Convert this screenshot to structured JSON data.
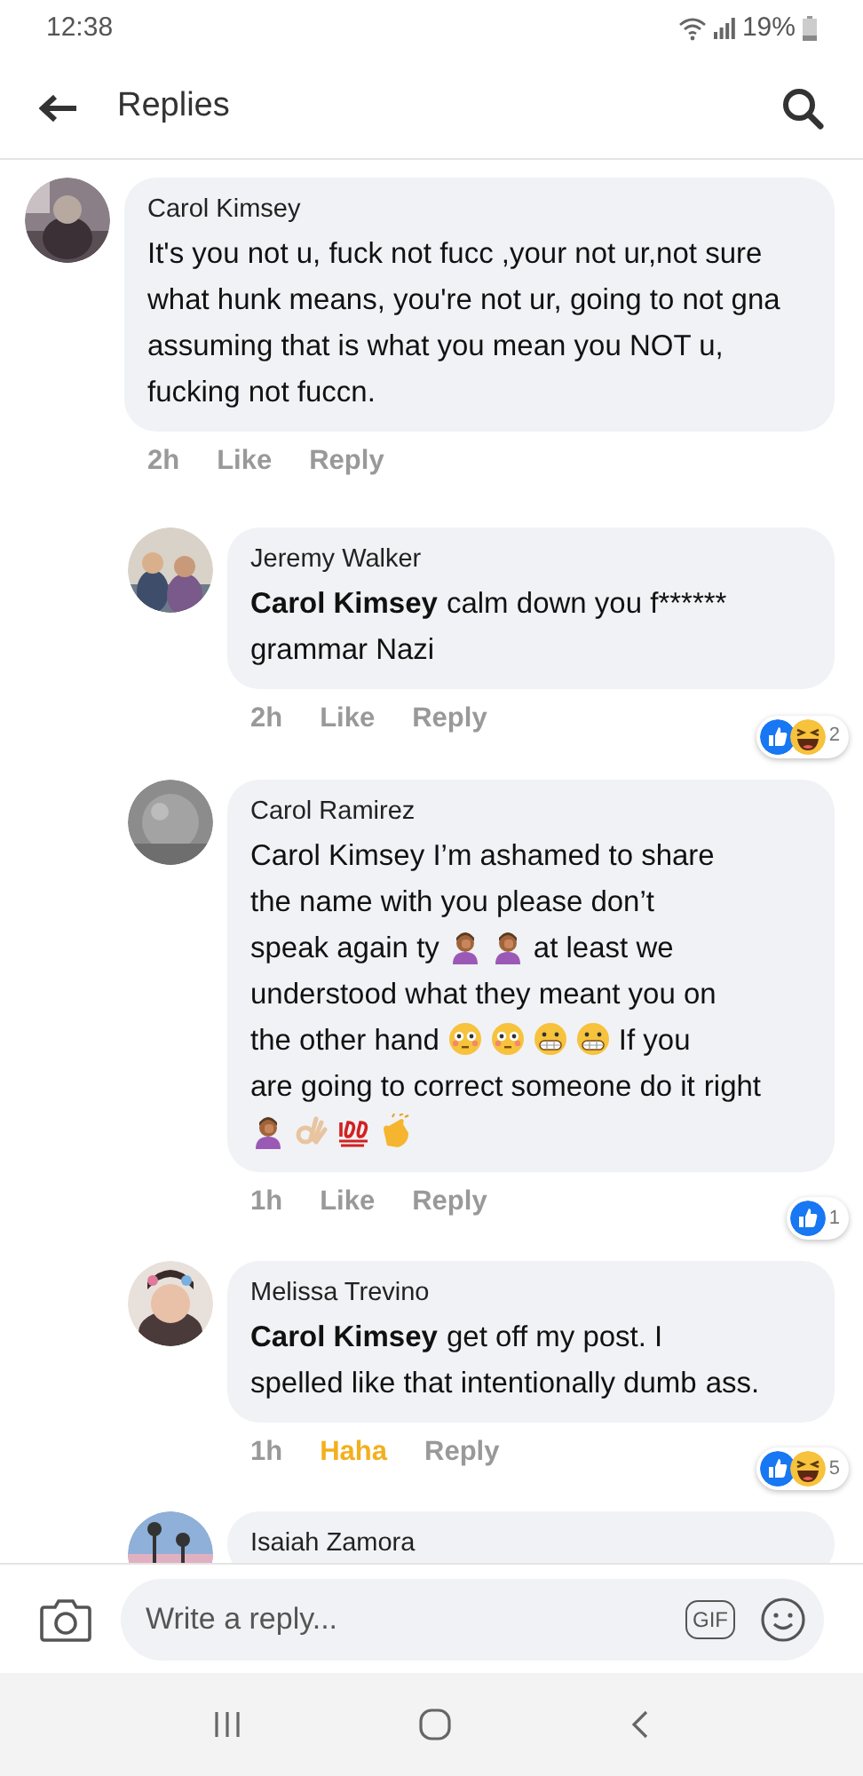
{
  "status_bar": {
    "time": "12:38",
    "battery": "19%"
  },
  "header": {
    "title": "Replies"
  },
  "comments": [
    {
      "author": "Carol Kimsey",
      "body": [
        {
          "kind": "text",
          "text": "It's you not u, fuck not fucc ,your not ur,not sure what hunk means, you're not ur, going to not gna assuming that is what you mean  you NOT u, fucking not fuccn."
        }
      ],
      "time": "2h",
      "like_label": "Like",
      "reacted": false,
      "reply_label": "Reply",
      "children": [
        {
          "author": "Jeremy Walker",
          "body": [
            {
              "kind": "mention",
              "text": "Carol Kimsey"
            },
            {
              "kind": "line",
              "text": "calm down you f******"
            },
            {
              "kind": "line",
              "text": "grammar Nazi"
            }
          ],
          "time": "2h",
          "like_label": "Like",
          "reacted": false,
          "reply_label": "Reply",
          "reactions": [
            {
              "kind": "like"
            },
            {
              "kind": "haha"
            }
          ],
          "reaction_count": "2"
        },
        {
          "author": "Carol Ramirez",
          "body": [
            {
              "kind": "line",
              "text": "Carol Kimsey I’m ashamed to share"
            },
            {
              "kind": "line",
              "text": "the name with you please don’t"
            },
            {
              "kind": "line",
              "text": "speak again ty"
            },
            {
              "kind": "facepalm"
            },
            {
              "kind": "facepalm"
            },
            {
              "kind": "line",
              "text": "at least we"
            },
            {
              "kind": "line",
              "text": "understood what they meant you on"
            },
            {
              "kind": "line",
              "text": "the other hand"
            },
            {
              "kind": "flushed"
            },
            {
              "kind": "flushed"
            },
            {
              "kind": "grimace"
            },
            {
              "kind": "grimace"
            },
            {
              "kind": "line",
              "text": "If you"
            },
            {
              "kind": "line",
              "text": "are going to correct someone do it"
            },
            {
              "kind": "line",
              "text": "right"
            },
            {
              "kind": "facepalm"
            },
            {
              "kind": "okhand"
            },
            {
              "kind": "hundred"
            },
            {
              "kind": "clap"
            }
          ],
          "time": "1h",
          "like_label": "Like",
          "reacted": false,
          "reply_label": "Reply",
          "reactions": [
            {
              "kind": "like"
            }
          ],
          "reaction_count": "1"
        },
        {
          "author": "Melissa Trevino",
          "body": [
            {
              "kind": "mention",
              "text": "Carol Kimsey"
            },
            {
              "kind": "line",
              "text": "get off my post. I"
            },
            {
              "kind": "line",
              "text": "spelled like that intentionally dumb"
            },
            {
              "kind": "line",
              "text": "ass."
            }
          ],
          "time": "1h",
          "like_label": "Haha",
          "reacted": true,
          "reply_label": "Reply",
          "reactions": [
            {
              "kind": "like"
            },
            {
              "kind": "haha"
            }
          ],
          "reaction_count": "5"
        },
        {
          "author": "Isaiah Zamora"
        }
      ]
    }
  ],
  "composer": {
    "placeholder": "Write a reply...",
    "gif_label": "GIF"
  }
}
